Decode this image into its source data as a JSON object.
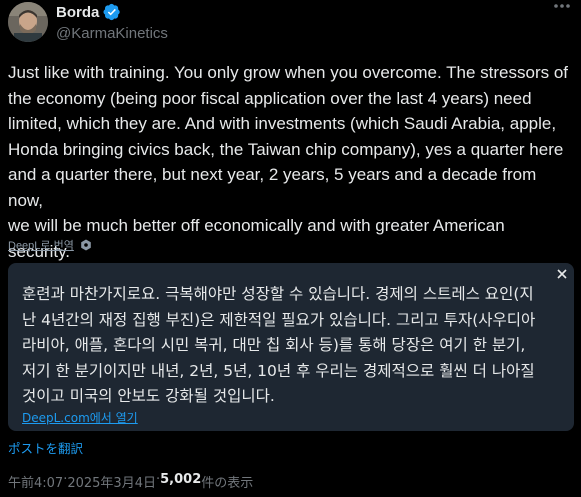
{
  "author": {
    "display_name": "Borda",
    "handle": "@KarmaKinetics"
  },
  "post": {
    "text": "Just like with training. You only grow when you overcome. The stressors of\nthe economy (being poor fiscal application over the last 4 years) need\nlimited, which they are. And with investments (which Saudi Arabia, apple,\nHonda bringing civics back, the Taiwan chip company), yes a quarter here\nand a quarter there, but next year, 2 years, 5 years and a decade from now,\nwe will be much better off economically and with greater American\nsecurity."
  },
  "deepl": {
    "translate_label": "DeepL로 번역",
    "translation": "훈련과 마찬가지로요. 극복해야만 성장할 수 있습니다. 경제의 스트레스 요인(지\n난 4년간의 재정 집행 부진)은 제한적일 필요가 있습니다. 그리고 투자(사우디아\n라비아, 애플, 혼다의 시민 복귀, 대만 칩 회사 등)를 통해 당장은 여기 한 분기,\n저기 한 분기이지만 내년, 2년, 5년, 10년 후 우리는 경제적으로 훨씬 더 나아질\n것이고 미국의 안보도 강화될 것입니다.",
    "open_label": "DeepL.com에서 열기"
  },
  "translate_post_label": "ポストを翻訳",
  "meta": {
    "time": "午前4:07",
    "sep1": " · ",
    "date": "2025年3月4日",
    "sep2": " · ",
    "views_count": "5,002",
    "views_label": " 件の表示"
  },
  "icons": {
    "verified": "verified-badge-icon",
    "more": "more-icon",
    "close": "close-icon",
    "deepl": "deepl-gear-icon"
  },
  "colors": {
    "accent": "#1d9bf0",
    "background": "#000000",
    "translation_box": "#1e2732"
  }
}
